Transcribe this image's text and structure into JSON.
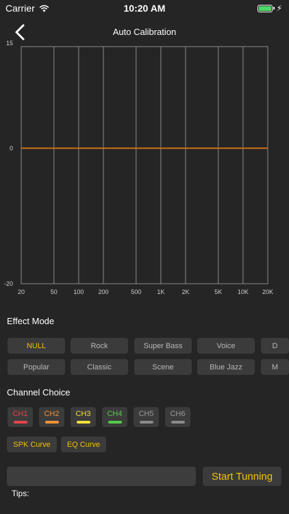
{
  "status_bar": {
    "carrier": "Carrier",
    "time": "10:20 AM",
    "battery_color": "#4cd964"
  },
  "nav": {
    "title": "Auto Calibration",
    "back_icon": "chevron-left-icon"
  },
  "chart_data": {
    "type": "line",
    "x_scale": "log",
    "x_ticks": [
      "20",
      "50",
      "100",
      "200",
      "500",
      "1K",
      "2K",
      "5K",
      "10K",
      "20K"
    ],
    "x_tick_values": [
      20,
      50,
      100,
      200,
      500,
      1000,
      2000,
      5000,
      10000,
      20000
    ],
    "y_ticks": [
      "15",
      "0",
      "-20"
    ],
    "y_tick_values": [
      15,
      0,
      -20
    ],
    "ylim": [
      -20,
      15
    ],
    "xlim": [
      20,
      20000
    ],
    "grid": true,
    "series": [
      {
        "x": [
          20,
          20000
        ],
        "y": [
          0,
          0
        ],
        "color": "#d06f1a"
      }
    ]
  },
  "effect_mode": {
    "title": "Effect Mode",
    "row1": [
      "NULL",
      "Rock",
      "Super Bass",
      "Voice",
      "D"
    ],
    "row2": [
      "Popular",
      "Classic",
      "Scene",
      "Blue Jazz",
      "M"
    ],
    "active": "NULL"
  },
  "channel_choice": {
    "title": "Channel Choice",
    "channels": [
      {
        "label": "CH1",
        "color": "#e8434c"
      },
      {
        "label": "CH2",
        "color": "#f0933a"
      },
      {
        "label": "CH3",
        "color": "#f2e03a"
      },
      {
        "label": "CH4",
        "color": "#56c94a"
      },
      {
        "label": "CH5",
        "color": "#8a8a8a"
      },
      {
        "label": "CH6",
        "color": "#8a8a8a"
      }
    ]
  },
  "curves": {
    "spk": "SPK Curve",
    "eq": "EQ Curve"
  },
  "tuning": {
    "input_value": "",
    "start_label": "Start Tunning",
    "tips_label": "Tips:"
  },
  "colors": {
    "accent": "#f2c200",
    "background": "#252525",
    "button_bg": "#3b3b3b"
  }
}
